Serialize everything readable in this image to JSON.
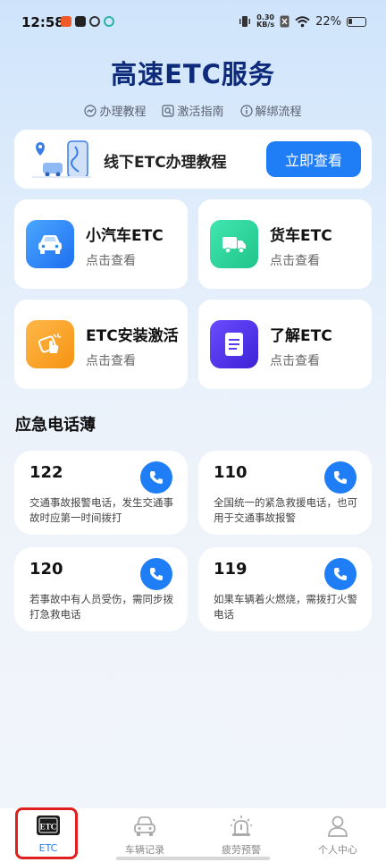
{
  "status_bar": {
    "time": "12:58",
    "speed_value": "0.30",
    "speed_unit": "KB/s",
    "battery": "22%"
  },
  "page": {
    "title": "高速ETC服务",
    "subnav": [
      {
        "label": "办理教程",
        "icon": "chart-circle-icon"
      },
      {
        "label": "激活指南",
        "icon": "search-doc-icon"
      },
      {
        "label": "解绑流程",
        "icon": "info-icon"
      }
    ]
  },
  "banner": {
    "text": "线下ETC办理教程",
    "button": "立即查看"
  },
  "services": [
    {
      "title": "小汽车ETC",
      "sub": "点击查看",
      "icon": "car-icon",
      "color": "#2f8cf7"
    },
    {
      "title": "货车ETC",
      "sub": "点击查看",
      "icon": "truck-icon",
      "color": "#2fd39a"
    },
    {
      "title": "ETC安装激活",
      "sub": "点击查看",
      "icon": "activate-icon",
      "color": "#f7a21f"
    },
    {
      "title": "了解ETC",
      "sub": "点击查看",
      "icon": "document-icon",
      "color": "#5b3df0"
    }
  ],
  "emergency": {
    "title": "应急电话薄",
    "items": [
      {
        "number": "122",
        "desc": "交通事故报警电话，发生交通事故时应第一时间拨打"
      },
      {
        "number": "110",
        "desc": "全国统一的紧急救援电话，也可用于交通事故报警"
      },
      {
        "number": "120",
        "desc": "若事故中有人员受伤，需同步拨打急救电话"
      },
      {
        "number": "119",
        "desc": "如果车辆着火燃烧，需拨打火警电话"
      }
    ]
  },
  "tabbar": {
    "etc_badge": "ETC",
    "items": [
      {
        "label": "ETC",
        "icon": "etc-tab-icon"
      },
      {
        "label": "车辆记录",
        "icon": "car-record-icon"
      },
      {
        "label": "疲劳预警",
        "icon": "warning-light-icon"
      },
      {
        "label": "个人中心",
        "icon": "user-icon"
      }
    ]
  },
  "colors": {
    "accent": "#1f7ef5",
    "title": "#0e2a7a",
    "highlight": "#e01f1f"
  }
}
